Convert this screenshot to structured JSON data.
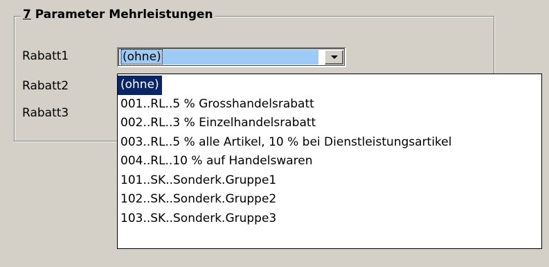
{
  "group": {
    "title_mnemonic": "7",
    "title_rest": " Parameter Mehrleistungen"
  },
  "fields": {
    "rabatt1_label": "Rabatt1",
    "rabatt2_label": "Rabatt2",
    "rabatt3_label": "Rabatt3"
  },
  "combo": {
    "selected_value": "(ohne)",
    "button_icon": "chevron-down-icon"
  },
  "dropdown": {
    "options": [
      "(ohne)",
      "001..RL..5 % Grosshandelsrabatt",
      "002..RL..3 % Einzelhandelsrabatt",
      "003..RL..5 % alle Artikel, 10 % bei Dienstleistungsartikel",
      "004..RL..10 % auf Handelswaren",
      "101..SK..Sonderk.Gruppe1",
      "102..SK..Sonderk.Gruppe2",
      "103..SK..Sonderk.Gruppe3"
    ],
    "highlighted_index": 0
  },
  "colors": {
    "window_bg": "#d4d0c8",
    "selection_bg": "#0a246a",
    "combo_value_bg": "#9ecbf6"
  }
}
